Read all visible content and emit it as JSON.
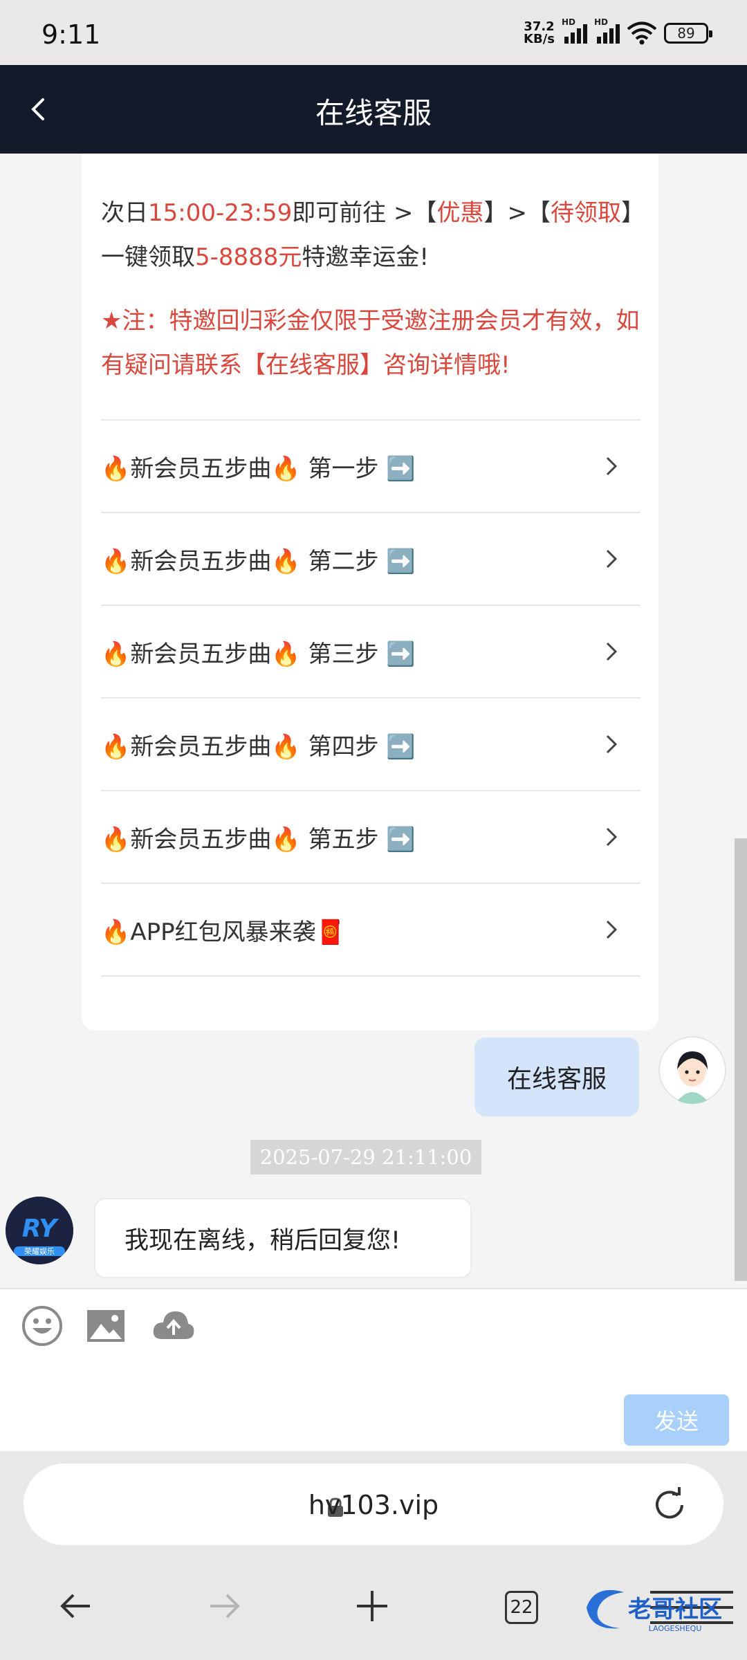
{
  "status_bar": {
    "time": "9:11",
    "speed_top": "37.2",
    "speed_bottom": "KB/s",
    "battery": "89",
    "sim_label": "HD"
  },
  "header": {
    "title": "在线客服"
  },
  "card": {
    "line1_a": "次日",
    "line1_time": "15:00-23:59",
    "line1_b": "即可前往 >【",
    "line1_youhui": "优惠",
    "line1_c": "】>【",
    "line1_daily": "待领取",
    "line1_d": "】",
    "line2_a": "一键领取",
    "line2_amount": "5-8888元",
    "line2_b": "特邀幸运金!",
    "note": "★注：特邀回归彩金仅限于受邀注册会员才有效，如有疑问请联系【在线客服】咨询详情哦!",
    "menu": [
      {
        "label": "🔥新会员五步曲🔥 第一步 ➡️"
      },
      {
        "label": "🔥新会员五步曲🔥 第二步 ➡️"
      },
      {
        "label": "🔥新会员五步曲🔥 第三步 ➡️"
      },
      {
        "label": "🔥新会员五步曲🔥 第四步 ➡️"
      },
      {
        "label": "🔥新会员五步曲🔥 第五步 ➡️"
      },
      {
        "label": "🔥APP红包风暴来袭🧧"
      }
    ]
  },
  "messages": {
    "outgoing": "在线客服",
    "timestamp": "2025-07-29 21:11:00",
    "incoming": "我现在离线，稍后回复您!",
    "bot_logo_text": "RY",
    "bot_logo_sub": "荣耀娱乐"
  },
  "input": {
    "send_label": "发送"
  },
  "browser": {
    "url": "hv103.vip",
    "tab_count": "22",
    "watermark": "老哥社区",
    "watermark_sub": "LAOGESHEQU"
  },
  "colors": {
    "header_bg": "#131b2b",
    "accent_red": "#d9473d",
    "bubble_out": "#d4e4fb",
    "send_btn": "#a9d0fb"
  }
}
